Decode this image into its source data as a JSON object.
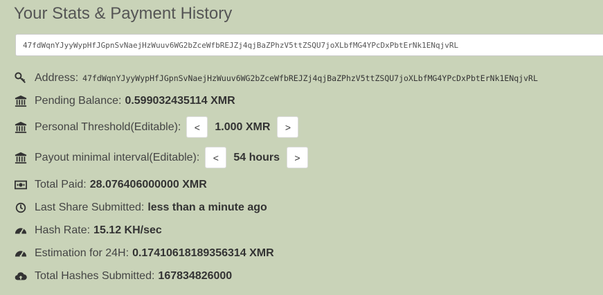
{
  "page": {
    "title": "Your Stats & Payment History"
  },
  "address_input": {
    "value": "47fdWqnYJyyWypHfJGpnSvNaejHzWuuv6WG2bZceWfbREJZj4qjBaZPhzV5ttZSQU7joXLbfMG4YPcDxPbtErNk1ENqjvRL"
  },
  "stats": {
    "address": {
      "label": "Address:",
      "value": "47fdWqnYJyyWypHfJGpnSvNaejHzWuuv6WG2bZceWfbREJZj4qjBaZPhzV5ttZSQU7joXLbfMG4YPcDxPbtErNk1ENqjvRL",
      "icon": "key-icon"
    },
    "pending_balance": {
      "label": "Pending Balance:",
      "value": "0.599032435114 XMR",
      "icon": "bank-icon"
    },
    "personal_threshold": {
      "label": "Personal Threshold(Editable):",
      "value": "1.000 XMR",
      "decrease": "<",
      "increase": ">",
      "icon": "bank-icon"
    },
    "payout_interval": {
      "label": "Payout minimal interval(Editable):",
      "value": "54 hours",
      "decrease": "<",
      "increase": ">",
      "icon": "bank-icon"
    },
    "total_paid": {
      "label": "Total Paid:",
      "value": "28.076406000000 XMR",
      "icon": "money-icon"
    },
    "last_share": {
      "label": "Last Share Submitted:",
      "value": "less than a minute ago",
      "icon": "clock-icon"
    },
    "hash_rate": {
      "label": "Hash Rate:",
      "value": "15.12 KH/sec",
      "icon": "dashboard-icon"
    },
    "estimation": {
      "label": "Estimation for 24H:",
      "value": "0.17410618189356314 XMR",
      "icon": "dashboard-icon"
    },
    "total_hashes": {
      "label": "Total Hashes Submitted:",
      "value": "167834826000",
      "icon": "cloud-upload-icon"
    }
  }
}
